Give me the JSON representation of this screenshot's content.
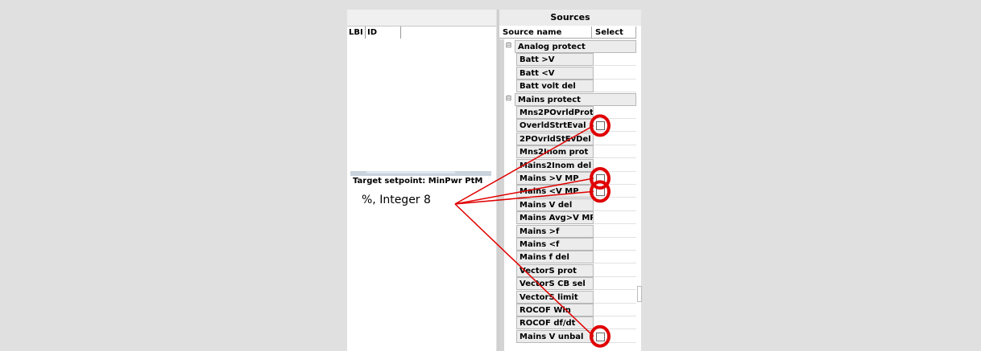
{
  "left_panel": {
    "columns": [
      "LBI",
      "ID"
    ],
    "target_setpoint": "Target setpoint: MinPwr PtM",
    "value_type": "%, Integer 8"
  },
  "sources_panel": {
    "title": "Sources",
    "columns": [
      "Source name",
      "Select"
    ],
    "rows": [
      {
        "name": "Analog protect",
        "group": true
      },
      {
        "name": "Batt >V"
      },
      {
        "name": "Batt <V"
      },
      {
        "name": "Batt volt del"
      },
      {
        "name": "Mains protect",
        "group": true
      },
      {
        "name": "Mns2POvrldProt"
      },
      {
        "name": "OverldStrtEval",
        "checkbox": true
      },
      {
        "name": "2POvrldStEvDel"
      },
      {
        "name": "Mns2Inom prot"
      },
      {
        "name": "Mains2Inom del"
      },
      {
        "name": "Mains >V MP",
        "checkbox": true
      },
      {
        "name": "Mains <V MP",
        "checkbox": true
      },
      {
        "name": "Mains V del"
      },
      {
        "name": "Mains Avg>V MP"
      },
      {
        "name": "Mains >f"
      },
      {
        "name": "Mains <f"
      },
      {
        "name": "Mains f del"
      },
      {
        "name": "VectorS prot"
      },
      {
        "name": "VectorS CB sel"
      },
      {
        "name": "VectorS limit"
      },
      {
        "name": "ROCOF Win"
      },
      {
        "name": "ROCOF df/dt"
      },
      {
        "name": "Mains V unbal",
        "checkbox": true
      }
    ]
  },
  "annotation": {
    "color": "#e00000",
    "highlighted_checkboxes": [
      "OverldStrtEval",
      "Mains >V MP",
      "Mains <V MP",
      "Mains V unbal"
    ]
  }
}
